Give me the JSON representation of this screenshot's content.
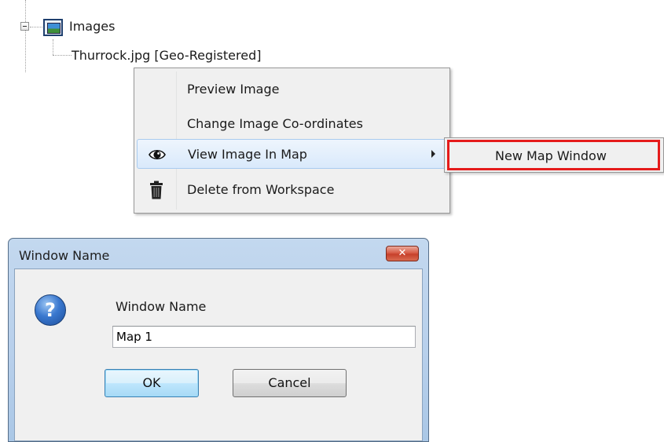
{
  "tree": {
    "folder_label": "Images",
    "file_label": "Thurrock.jpg [Geo-Registered]"
  },
  "context_menu": {
    "items": [
      {
        "label": "Preview Image",
        "icon": null
      },
      {
        "label": "Change Image Co-ordinates",
        "icon": null
      },
      {
        "label": "View Image In Map",
        "icon": "eye-icon",
        "has_submenu": true,
        "highlighted": true
      },
      {
        "label": "Delete from Workspace",
        "icon": "trash-icon"
      }
    ]
  },
  "submenu": {
    "items": [
      {
        "label": "New Map Window",
        "highlight_color": "#e51b1b"
      }
    ]
  },
  "dialog": {
    "title": "Window Name",
    "close_glyph": "✕",
    "icon": "question-icon",
    "prompt": "Window Name",
    "input_value": "Map 1",
    "ok_label": "OK",
    "cancel_label": "Cancel"
  },
  "colors": {
    "menu_bg": "#f0f0f0",
    "highlight_border": "#a8cbef",
    "red_outline": "#e51b1b",
    "dialog_frame": "#b7cfeb"
  }
}
